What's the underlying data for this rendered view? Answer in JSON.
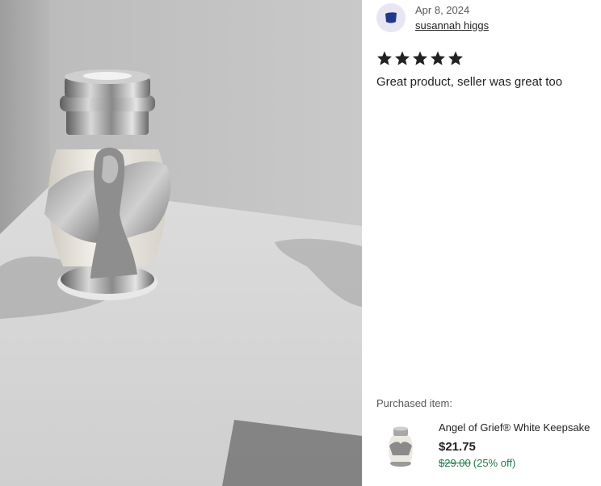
{
  "review": {
    "date": "Apr 8, 2024",
    "reviewer_name": "susannah higgs",
    "rating": 5,
    "rating_max": 5,
    "text": "Great product, seller was great too"
  },
  "purchased": {
    "label": "Purchased item:",
    "title": "Angel of Grief® White Keepsake",
    "price": "$21.75",
    "original_price": "$29.00",
    "discount": "(25% off)"
  },
  "photo": {
    "icon": "angel-urn-photo"
  },
  "colors": {
    "avatar_bg": "#e7e6f3",
    "avatar_icon": "#1f3a8a",
    "star": "#222222",
    "discount_green": "#1e7a4a"
  }
}
